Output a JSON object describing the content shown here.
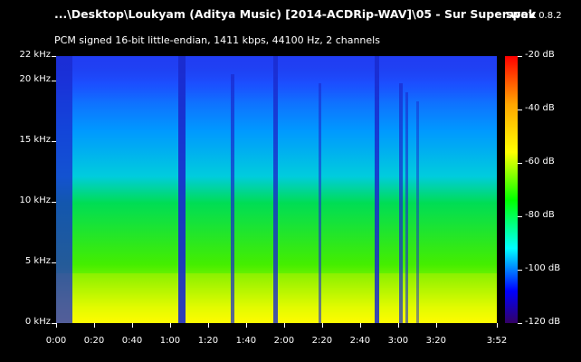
{
  "title": "...\\Desktop\\Loukyam (Aditya Music) [2014-ACDRip-WAV]\\05 - Sur Super.wav",
  "app": {
    "name": "spek",
    "version": "0.8.2"
  },
  "info": "PCM signed 16-bit little-endian, 1411 kbps, 44100 Hz, 2 channels",
  "freq_axis": [
    {
      "label": "22 kHz",
      "value": 22
    },
    {
      "label": "20 kHz",
      "value": 20
    },
    {
      "label": "15 kHz",
      "value": 15
    },
    {
      "label": "10 kHz",
      "value": 10
    },
    {
      "label": "5 kHz",
      "value": 5
    },
    {
      "label": "0 kHz",
      "value": 0
    }
  ],
  "time_axis": [
    {
      "label": "0:00",
      "value": 0
    },
    {
      "label": "0:20",
      "value": 20
    },
    {
      "label": "0:40",
      "value": 40
    },
    {
      "label": "1:00",
      "value": 60
    },
    {
      "label": "1:20",
      "value": 80
    },
    {
      "label": "1:40",
      "value": 100
    },
    {
      "label": "2:00",
      "value": 120
    },
    {
      "label": "2:20",
      "value": 140
    },
    {
      "label": "2:40",
      "value": 160
    },
    {
      "label": "3:00",
      "value": 180
    },
    {
      "label": "3:20",
      "value": 200
    },
    {
      "label": "3:52",
      "value": 232
    }
  ],
  "db_axis": [
    {
      "label": "-20 dB",
      "value": -20
    },
    {
      "label": "-40 dB",
      "value": -40
    },
    {
      "label": "-60 dB",
      "value": -60
    },
    {
      "label": "-80 dB",
      "value": -80
    },
    {
      "label": "-100 dB",
      "value": -100
    },
    {
      "label": "-120 dB",
      "value": -120
    }
  ],
  "duration_seconds": 232,
  "max_freq_khz": 22,
  "colors": {
    "background": "#000000",
    "text": "#ffffff"
  }
}
